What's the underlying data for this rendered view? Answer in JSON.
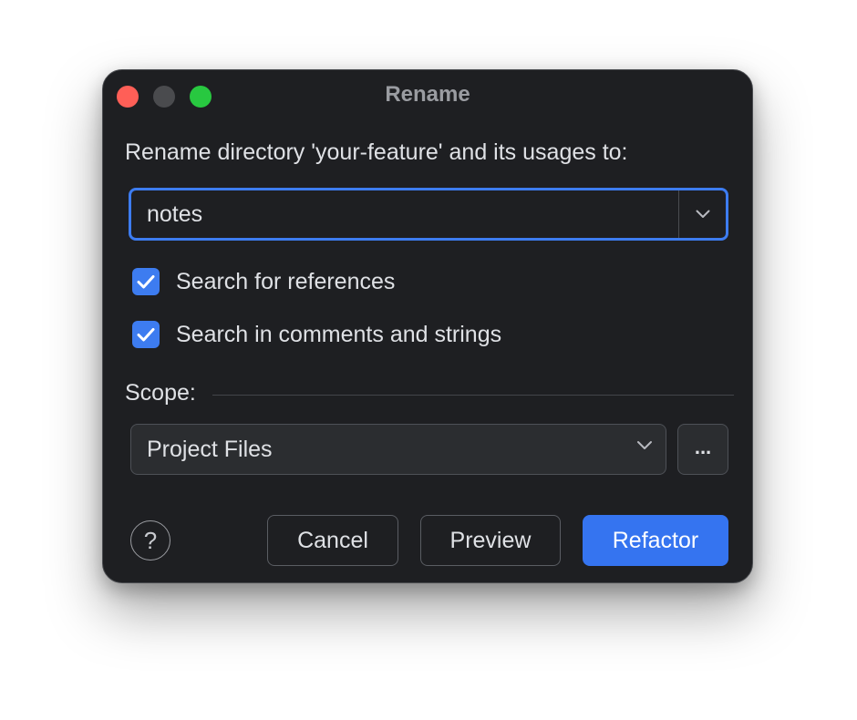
{
  "window": {
    "title": "Rename"
  },
  "dialog": {
    "prompt": "Rename directory 'your-feature' and its usages to:",
    "name_value": "notes",
    "options": [
      {
        "label": "Search for references",
        "checked": true
      },
      {
        "label": "Search in comments and strings",
        "checked": true
      }
    ],
    "scope_label": "Scope:",
    "scope_value": "Project Files",
    "browse_label": "...",
    "help_label": "?"
  },
  "buttons": {
    "cancel": "Cancel",
    "preview": "Preview",
    "refactor": "Refactor"
  },
  "colors": {
    "accent": "#3574f0",
    "background": "#1e1f22",
    "close": "#ff5f57",
    "minimize": "#4a4b4e",
    "zoom": "#28c840"
  },
  "icons": {
    "combo_arrow": "chevron-down-icon",
    "scope_arrow": "chevron-down-icon",
    "checkbox": "checkmark-icon",
    "help": "question-mark-icon"
  }
}
